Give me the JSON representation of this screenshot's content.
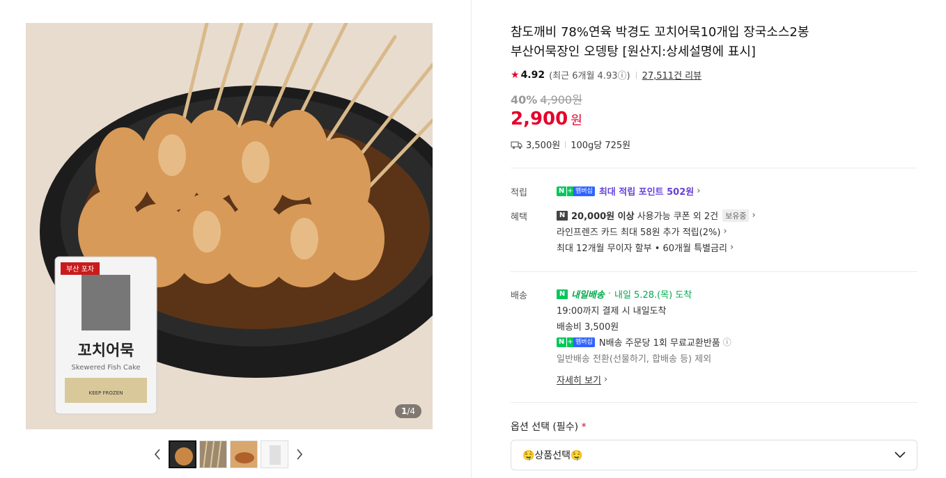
{
  "gallery": {
    "counter_current": "1",
    "counter_total": "/4",
    "package_label_top": "부산 포차",
    "package_title": "꼬치어묵",
    "package_subtitle": "Skewered Fish Cake",
    "package_keep": "KEEP FROZEN"
  },
  "product": {
    "title_line1": "참도깨비 78%연육 박경도 꼬치어묵10개입 장국소스2봉",
    "title_line2": "부산어묵장인 오뎅탕 [원산지:상세설명에 표시]",
    "rating_score": "4.92",
    "rating_recent": "(최근 6개월 4.93ⓘ)",
    "review_count": "27,511건 리뷰",
    "discount_pct": "40%",
    "original_price": "4,900원",
    "price": "2,900",
    "price_unit": "원",
    "shipping_fee": "3,500원",
    "unit_price": "100g당 725원"
  },
  "benefits": {
    "points_label": "적립",
    "points_text": "최대 적립 포인트 502원",
    "membership_badge": "멤버십",
    "benefit_label": "혜택",
    "coupon_bold": "20,000원 이상",
    "coupon_text": "사용가능 쿠폰 외 2건",
    "coupon_status": "보유중",
    "card_text": "라인프렌즈 카드 최대 58원 추가 적립(2%)",
    "installment_text": "최대 12개월 무이자 할부 • 60개월 특별금리"
  },
  "delivery": {
    "label": "배송",
    "fast_label": "내일배송",
    "arrival": "내일 5.28.(목) 도착",
    "cutoff": "19:00까지 결제 시 내일도착",
    "fee": "배송비 3,500원",
    "exchange": "N배송 주문당 1회 무료교환반품",
    "note": "일반배송 전환(선물하기, 합배송 등) 제외",
    "details_link": "자세히 보기"
  },
  "options": {
    "label": "옵션 선택 (필수)",
    "required_mark": "*",
    "select_value": "🤤상품선택🤤"
  },
  "colors": {
    "price_red": "#e4002b",
    "naver_green": "#03c75a",
    "points_purple": "#6741d9"
  }
}
